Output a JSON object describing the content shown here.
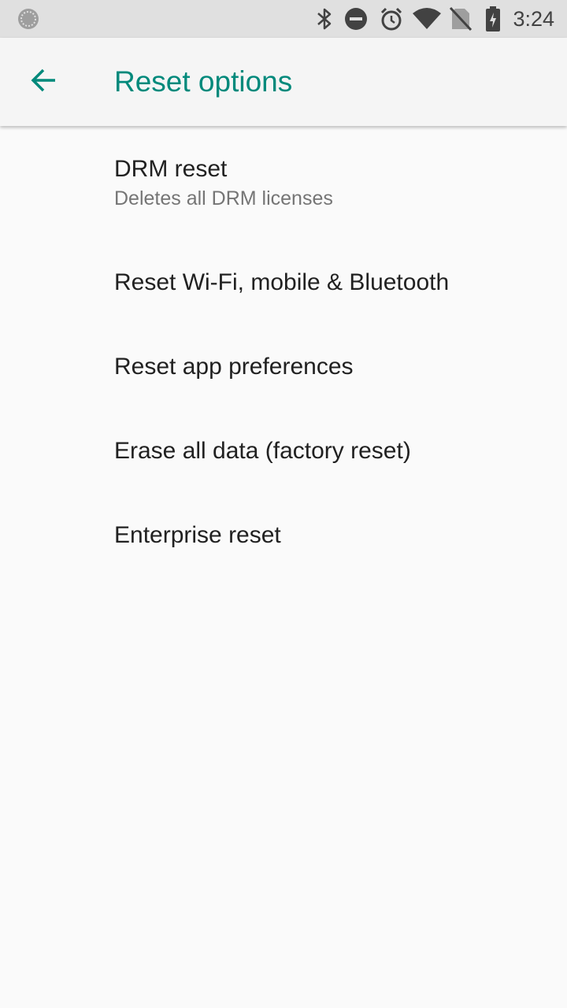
{
  "status_bar": {
    "time": "3:24",
    "icons": [
      "sync-icon",
      "bluetooth-icon",
      "do-not-disturb-icon",
      "alarm-icon",
      "wifi-icon",
      "no-sim-icon",
      "battery-charging-icon"
    ]
  },
  "toolbar": {
    "back_icon": "arrow-back-icon",
    "title": "Reset options",
    "accent_color": "#00897b"
  },
  "items": [
    {
      "title": "DRM reset",
      "summary": "Deletes all DRM licenses"
    },
    {
      "title": "Reset Wi-Fi, mobile & Bluetooth"
    },
    {
      "title": "Reset app preferences"
    },
    {
      "title": "Erase all data (factory reset)"
    },
    {
      "title": "Enterprise reset"
    }
  ]
}
